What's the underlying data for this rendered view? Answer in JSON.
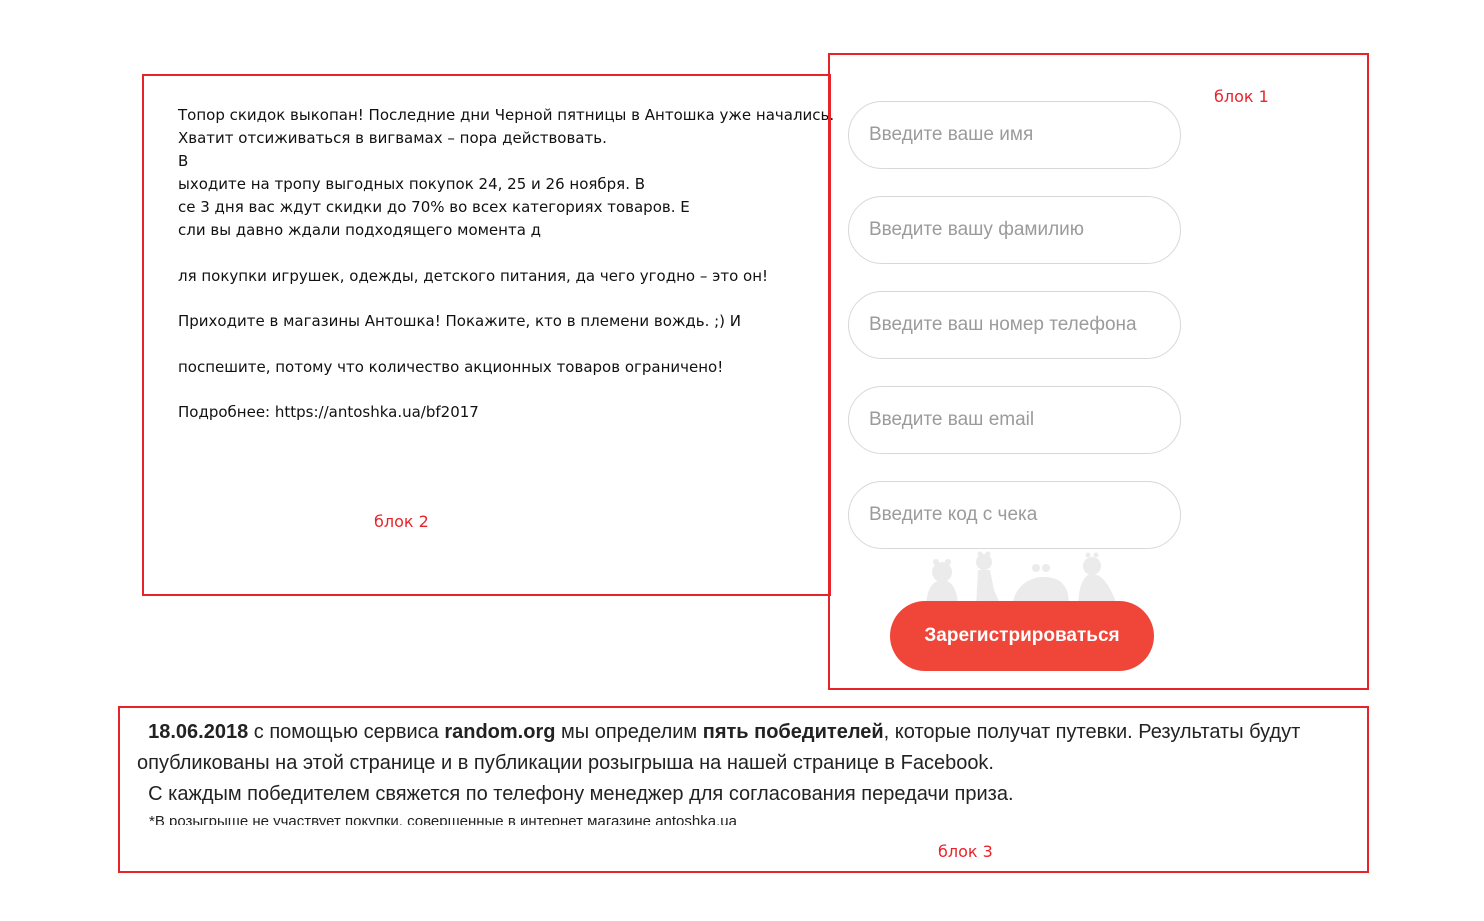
{
  "block2": {
    "tag": "блок 2",
    "lines": [
      "Топор скидок выкопан! Последние дни Черной пятницы в Антошка уже начались.",
      "Хватит отсиживаться в вигвамах – пора действовать.",
      "В",
      "ыходите на тропу выгодных покупок 24, 25 и 26 ноября. В",
      "се 3 дня вас ждут скидки до 70% во всех категориях товаров. Е",
      "сли вы давно ждали подходящего момента д",
      "ля покупки игрушек, одежды, детского питания, да чего угодно – это он!",
      "Приходите в магазины Антошка! Покажите, кто в племени вождь. ;) И",
      " поспешите, потому что количество акционных товаров ограничено!",
      "Подробнее: https://antoshka.ua/bf2017"
    ]
  },
  "block1": {
    "tag": "блок 1",
    "placeholders": {
      "name": "Введите ваше имя",
      "surname": "Введите вашу фамилию",
      "phone": "Введите ваш номер телефона",
      "email": "Введите ваш email",
      "receipt": "Введите код с чека"
    },
    "register_label": "Зарегистрироваться",
    "mascots_icon": "antoshka-mascots-icon"
  },
  "block3": {
    "tag": "блок 3",
    "date": "18.06.2018",
    "text_1": " с помощью сервиса ",
    "service": "random.org",
    "text_2": " мы определим ",
    "winners": "пять победителей",
    "text_3": ", которые получат путевки. Результаты будут опубликованы на этой странице и в публикации розыгрыша на нашей странице в Facebook.",
    "contact": "С каждым победителем свяжется по телефону менеджер для согласования передачи приза.",
    "footnote": "*В розыгрыше не участвует покупки, совершенные в интернет магазине antoshka.ua"
  },
  "colors": {
    "accent": "#f0463a",
    "frame": "#e8242b"
  }
}
